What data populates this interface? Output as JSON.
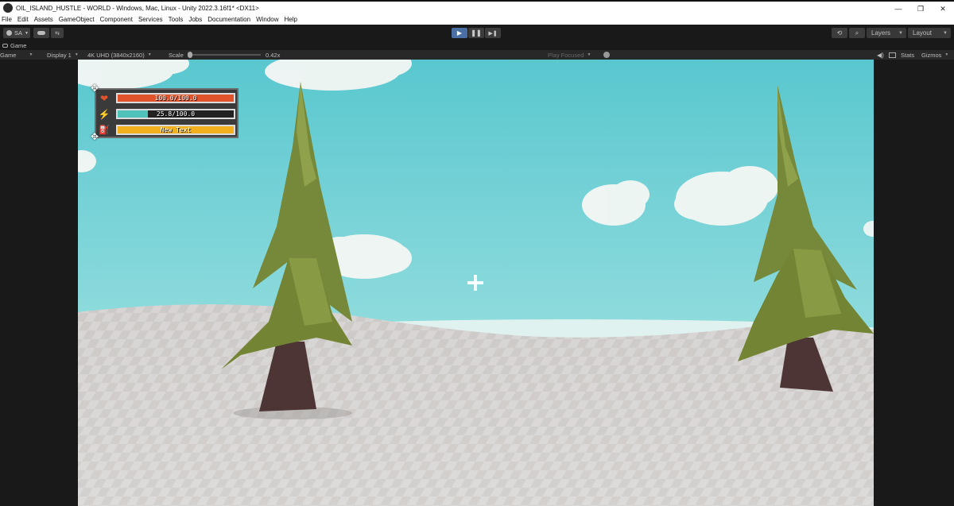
{
  "window": {
    "title": "OIL_ISLAND_HUSTLE - WORLD - Windows, Mac, Linux - Unity 2022.3.16f1* <DX11>",
    "controls": {
      "minimize": "—",
      "restore": "❐",
      "close": "✕"
    }
  },
  "menu": [
    "File",
    "Edit",
    "Assets",
    "GameObject",
    "Component",
    "Services",
    "Tools",
    "Jobs",
    "Documentation",
    "Window",
    "Help"
  ],
  "toolbar": {
    "account": "SA",
    "play_icon": "play-icon",
    "pause_icon": "pause-icon",
    "step_icon": "step-icon",
    "layers": "Layers",
    "layout": "Layout"
  },
  "tab": {
    "label": "Game"
  },
  "game_bar": {
    "mode": "Game",
    "display": "Display 1",
    "resolution": "4K UHD (3840x2160)",
    "scale_label": "Scale",
    "scale_value": "0.42x",
    "play_focused": "Play Focused",
    "stats": "Stats",
    "gizmos": "Gizmos"
  },
  "hud": {
    "health": {
      "text": "100.0/100.0",
      "fraction": 1.0,
      "color": "#e0532b"
    },
    "energy": {
      "text": "25.8/100.0",
      "fraction": 0.258,
      "color": "#4fc3b9"
    },
    "item": {
      "text": "New Text",
      "fraction": 1.0,
      "color": "#f2b01e"
    }
  },
  "colors": {
    "sky_top": "#59c7cf",
    "sky_bottom": "#b3e9e6",
    "ground": "#d8d6d3",
    "tree_foliage": "#7c8f38",
    "tree_trunk": "#4e3535"
  }
}
